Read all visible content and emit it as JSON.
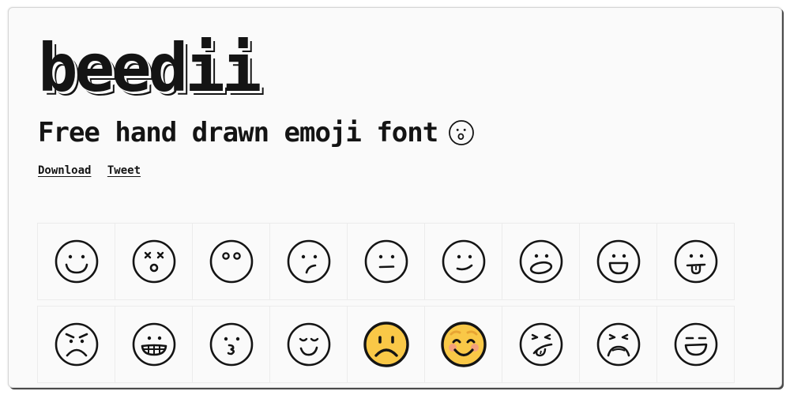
{
  "page": {
    "logo": "beedii",
    "tagline": "Free hand drawn emoji font",
    "tagline_emoji": "hushed-face",
    "links": [
      {
        "label": "Download"
      },
      {
        "label": "Tweet"
      }
    ]
  },
  "colors": {
    "text": "#141414",
    "background": "#fafafa",
    "emoji_yellow": "#f9c847",
    "blush": "#f4a07a",
    "brow": "#e8a533"
  },
  "emoji_grid": {
    "rows": [
      [
        {
          "name": "smiling-face"
        },
        {
          "name": "dizzy-face"
        },
        {
          "name": "wide-eyes-face"
        },
        {
          "name": "confused-face"
        },
        {
          "name": "neutral-face"
        },
        {
          "name": "smirk-face"
        },
        {
          "name": "open-mouth-face"
        },
        {
          "name": "grinning-face"
        },
        {
          "name": "tongue-out-face"
        }
      ],
      [
        {
          "name": "angry-face"
        },
        {
          "name": "grimacing-face"
        },
        {
          "name": "kissing-face"
        },
        {
          "name": "relieved-face"
        },
        {
          "name": "frowning-face-color"
        },
        {
          "name": "blushing-face-color"
        },
        {
          "name": "winking-tongue-face"
        },
        {
          "name": "persevering-face"
        },
        {
          "name": "laughing-face"
        }
      ]
    ]
  }
}
